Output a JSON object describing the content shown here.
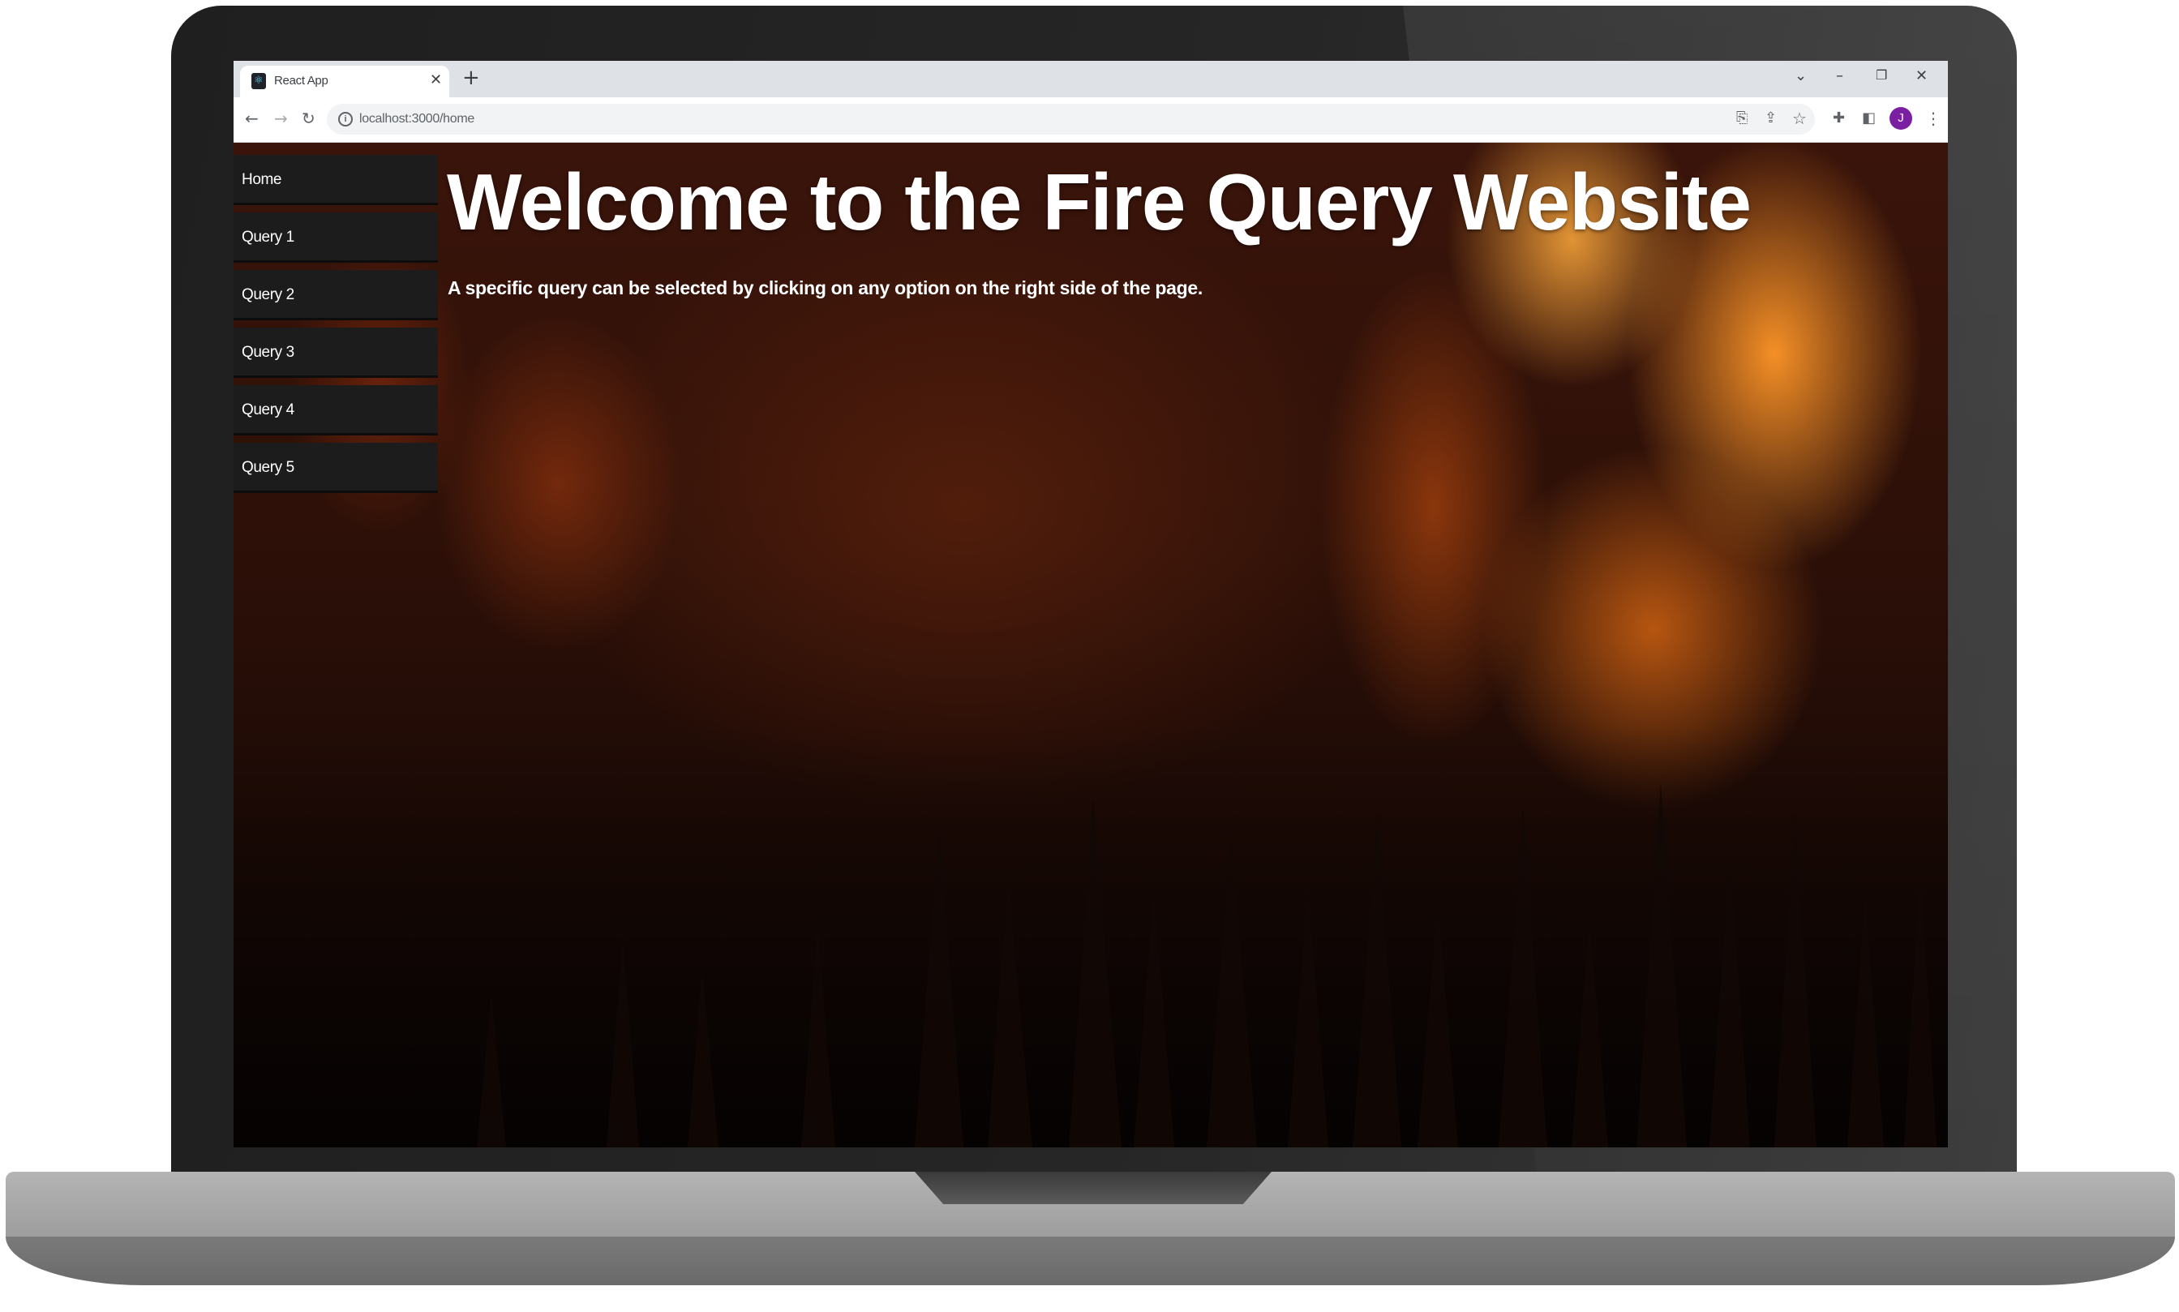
{
  "browser": {
    "tab_title": "React App",
    "url": "localhost:3000/home",
    "profile_initial": "J"
  },
  "sidebar": {
    "items": [
      {
        "label": "Home"
      },
      {
        "label": "Query 1"
      },
      {
        "label": "Query 2"
      },
      {
        "label": "Query 3"
      },
      {
        "label": "Query 4"
      },
      {
        "label": "Query 5"
      }
    ]
  },
  "main": {
    "title": "Welcome to the Fire Query Website",
    "subtitle": "A specific query can be selected by clicking on any option on the right side of the page."
  },
  "icons": {
    "tab_favicon": "react-logo-icon",
    "tab_close": "close-icon",
    "new_tab": "plus-icon",
    "back": "arrow-left-icon",
    "forward": "arrow-right-icon",
    "reload": "reload-icon",
    "site_info": "info-icon",
    "install": "install-app-icon",
    "share": "share-icon",
    "bookmark": "star-icon",
    "extensions": "puzzle-icon",
    "side_panel": "side-panel-icon",
    "menu": "kebab-menu-icon"
  },
  "colors": {
    "nav_bg": "#1c1c1c",
    "avatar_bg": "#7b1fa2",
    "tab_strip": "#dee1e6"
  }
}
